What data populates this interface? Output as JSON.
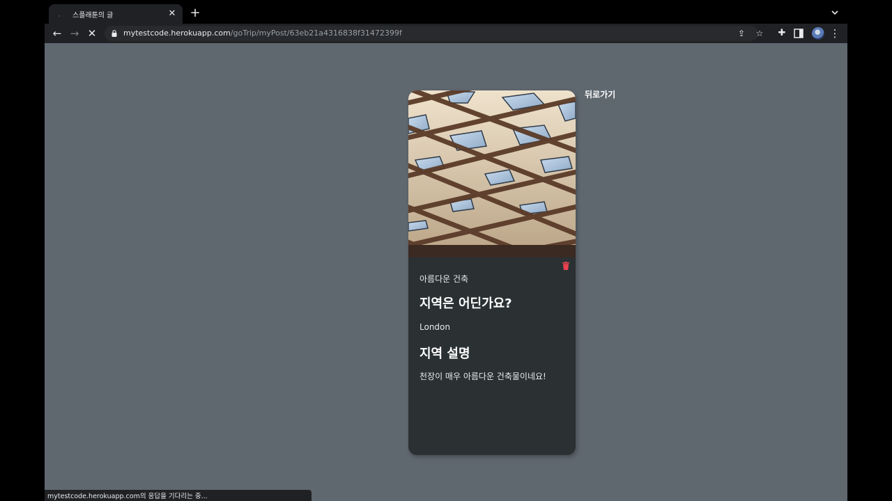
{
  "tab": {
    "title": "스플래툰의 글"
  },
  "address_bar": {
    "host": "mytestcode.herokuapp.com",
    "path": "/goTrip/myPost/63eb21a4316838f31472399f"
  },
  "post": {
    "category": "아름다운 건축",
    "question_heading": "지역은 어딘가요?",
    "location": "London",
    "description_heading": "지역 설명",
    "description": "천장이 매우 아름다운 건축물이네요!"
  },
  "back_link": "뒤로가기",
  "status_bar": "mytestcode.herokuapp.com의 응답을 기다리는 중...",
  "colors": {
    "page_bg": "#5f676f",
    "card_bg": "#2b3133",
    "trash": "#e8424f"
  },
  "icons": [
    "close-icon",
    "plus-icon",
    "chevron-down-icon",
    "back-arrow-icon",
    "forward-arrow-icon",
    "stop-loading-icon",
    "lock-icon",
    "share-icon",
    "star-icon",
    "extensions-icon",
    "side-panel-icon",
    "kebab-menu-icon",
    "trash-icon"
  ]
}
